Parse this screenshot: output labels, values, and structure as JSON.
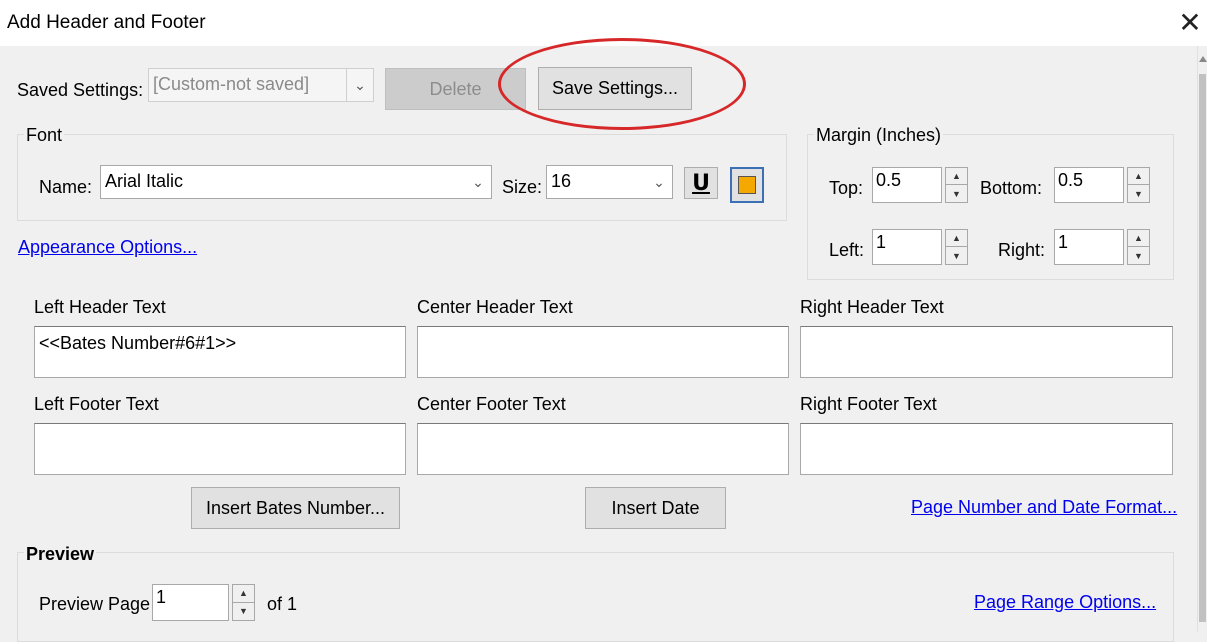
{
  "window": {
    "title": "Add Header and Footer",
    "close_icon": "close-icon"
  },
  "saved_settings": {
    "label": "Saved Settings:",
    "value": "[Custom-not saved]",
    "delete_label": "Delete",
    "save_label": "Save Settings..."
  },
  "font": {
    "group_label": "Font",
    "name_label": "Name:",
    "name_value": "Arial Italic",
    "size_label": "Size:",
    "size_value": "16",
    "underline_label": "U",
    "color": "#f5a800"
  },
  "margin": {
    "group_label": "Margin (Inches)",
    "top_label": "Top:",
    "top_value": "0.5",
    "bottom_label": "Bottom:",
    "bottom_value": "0.5",
    "left_label": "Left:",
    "left_value": "1",
    "right_label": "Right:",
    "right_value": "1"
  },
  "appearance_link": "Appearance Options...",
  "fields": {
    "left_header_label": "Left Header Text",
    "left_header_value": "<<Bates Number#6#1>>",
    "center_header_label": "Center Header Text",
    "center_header_value": "",
    "right_header_label": "Right Header Text",
    "right_header_value": "",
    "left_footer_label": "Left Footer Text",
    "left_footer_value": "",
    "center_footer_label": "Center Footer Text",
    "center_footer_value": "",
    "right_footer_label": "Right Footer Text",
    "right_footer_value": ""
  },
  "actions": {
    "insert_bates_label": "Insert Bates Number...",
    "insert_date_label": "Insert Date",
    "page_number_format_link": "Page Number and Date Format..."
  },
  "preview": {
    "group_label": "Preview",
    "page_label": "Preview Page",
    "page_value": "1",
    "of_label": "of 1",
    "page_range_link": "Page Range Options..."
  },
  "annotation_color": "#d62828"
}
